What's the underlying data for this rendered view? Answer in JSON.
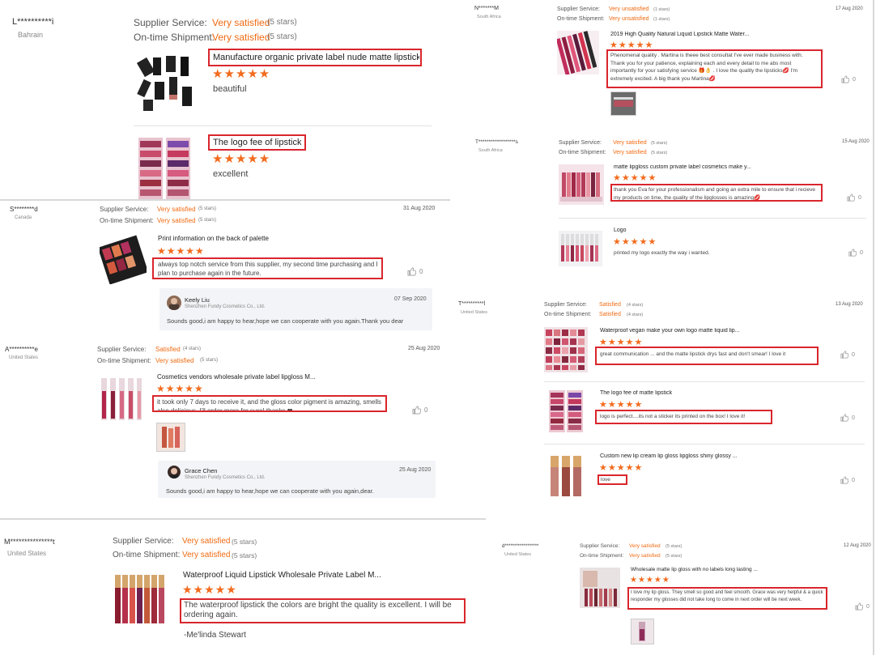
{
  "labels": {
    "supplier_service": "Supplier Service:",
    "on_time_shipment": "On-time Shipment:"
  },
  "colors": {
    "accent": "#f06a11",
    "highlight_box": "#d9262c",
    "star": "#f26b1d"
  },
  "icons": {
    "star": "star-icon",
    "like": "thumbs-up-icon"
  },
  "reviews": {
    "r1": {
      "user": "L**********i",
      "country": "Bahrain",
      "supplier_value": "Very satisfied",
      "supplier_stars": "(5 stars)",
      "shipment_value": "Very satisfied",
      "shipment_stars": "(5 stars)",
      "items": [
        {
          "title": "Manufacture organic private label nude matte lipstick ...",
          "rating": "★★★★★",
          "text": "beautiful"
        },
        {
          "title": "The logo fee of lipstick",
          "rating": "★★★★★",
          "text": "excellent"
        }
      ]
    },
    "r2": {
      "user": "S********d",
      "country": "Canada",
      "date": "31 Aug 2020",
      "supplier_value": "Very satisfied",
      "supplier_stars": "(5 stars)",
      "shipment_value": "Very satisfied",
      "shipment_stars": "(5 stars)",
      "items": [
        {
          "title": "Print information on the back of palette",
          "rating": "★★★★★",
          "text": "always top notch service from this supplier, my second time purchasing and I plan to purchase again in the future.",
          "likes": "0"
        }
      ],
      "reply": {
        "name": "Keely Liu",
        "company": "Shenzhen Fundy Cosmetics Co., Ltd.",
        "date": "07 Sep 2020",
        "text": "Sounds good,i am happy to hear,hope we can cooperate with you again.Thank you dear"
      }
    },
    "r3": {
      "user": "A**********e",
      "country": "United States",
      "date": "25 Aug 2020",
      "supplier_value": "Satisfied",
      "supplier_stars": "(4 stars)",
      "shipment_value": "Very satisfied",
      "shipment_stars": "(5 stars)",
      "items": [
        {
          "title": "Cosmetics vendors wholesale private label lipgloss M...",
          "rating": "★★★★★",
          "text": "it took only 7 days to receive it, and the gloss color pigment is amazing, smells also delicious. I'll order more for sure! thanks ❤",
          "likes": "0"
        }
      ],
      "reply": {
        "name": "Grace Chen",
        "company": "Shenzhen Fundy Cosmetics Co., Ltd.",
        "date": "25 Aug 2020",
        "text": "Sounds good,i am happy to hear,hope we can cooperate with you again,dear."
      }
    },
    "r4": {
      "user": "M***************t",
      "country": "United States",
      "supplier_value": "Very satisfied",
      "supplier_stars": "(5 stars)",
      "shipment_value": "Very satisfied",
      "shipment_stars": "(5 stars)",
      "items": [
        {
          "title": "Waterproof Liquid Lipstick Wholesale Private Label M...",
          "rating": "★★★★★",
          "text": "The waterproof lipstick the colors are bright the quality is excellent. I will be ordering again."
        }
      ],
      "signature": "-Me'linda Stewart"
    },
    "r5": {
      "user": "N*******M",
      "country": "South Africa",
      "date": "17 Aug 2020",
      "supplier_value": "Very unsatisfied",
      "supplier_stars": "(1 stars)",
      "shipment_value": "Very unsatisfied",
      "shipment_stars": "(1 stars)",
      "items": [
        {
          "title": "2019 High Quality Natural Liquid Lipstick Matte Water...",
          "rating": "★★★★★",
          "text": "Phenomenal quality . Martina is theee best consultat I've ever made business with. Thank you for your patience, explaining each and every detail to me abs most importantly for your satisfying service 🎁👌 . I love the quality the lipsticks💋 I'm extremely excited. A big thank you Martina💋",
          "likes": "0"
        }
      ]
    },
    "r6": {
      "user": "T******************s",
      "country": "South Africa",
      "date": "15 Aug 2020",
      "supplier_value": "Very satisfied",
      "supplier_stars": "(5 stars)",
      "shipment_value": "Very satisfied",
      "shipment_stars": "(5 stars)",
      "items": [
        {
          "title": "matte lipgloss custom private label cosmetics make y...",
          "rating": "★★★★★",
          "text": "thank you Eva for your professionalism and going an extra mile to ensure that i recieve my products on time, the quality of the lipglosses is amazing💋",
          "likes": "0"
        },
        {
          "title": "Logo",
          "rating": "★★★★★",
          "text": "printed my logo exactly the way i wanted.",
          "likes": "0"
        }
      ]
    },
    "r7": {
      "user": "T**********l",
      "country": "United States",
      "date": "13 Aug 2020",
      "supplier_value": "Satisfied",
      "supplier_stars": "(4 stars)",
      "shipment_value": "Satisfied",
      "shipment_stars": "(4 stars)",
      "items": [
        {
          "title": "Waterproof vegan make your own logo matte liquid lip...",
          "rating": "★★★★★",
          "text": "great communication ... and the matte lipstick drys fast and don't smear! I love it",
          "likes": "0"
        },
        {
          "title": "The logo fee of matte lipstick",
          "rating": "★★★★★",
          "text": "logo is perfect....its not a sticker its printed on the box! I love it!",
          "likes": "0"
        },
        {
          "title": "Custom new lip cream lip gloss lipgloss shiny glossy ...",
          "rating": "★★★★★",
          "text": "love",
          "likes": "0"
        }
      ]
    },
    "r8": {
      "user": "d******************",
      "country": "United States",
      "date": "12 Aug 2020",
      "supplier_value": "Very satisfied",
      "supplier_stars": "(5 stars)",
      "shipment_value": "Very satisfied",
      "shipment_stars": "(5 stars)",
      "items": [
        {
          "title": "Wholesale matte lip gloss with no labels long lasting ...",
          "rating": "★★★★★",
          "text": "I love my lip gloss. They smell so good and feel smooth. Grace was very helpful & a quick responder my glosses did not take long to come in next order will be next week.",
          "likes": "0"
        }
      ]
    }
  }
}
